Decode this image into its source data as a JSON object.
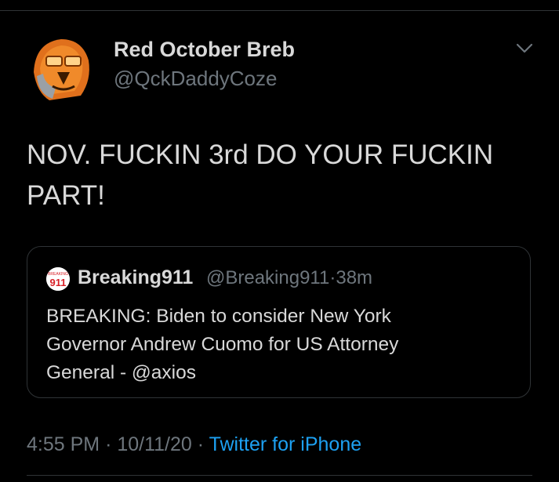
{
  "author": {
    "display_name": "Red October Breb",
    "handle": "@QckDaddyCoze",
    "avatar_icon": "hooded-mask-avatar"
  },
  "tweet": {
    "text_line1": "NOV. FUCKIN 3rd DO YOUR FUCKIN",
    "text_line2": "PART!"
  },
  "quoted_tweet": {
    "avatar_text": "911",
    "avatar_small_text": "BREAKING",
    "display_name": "Breaking911",
    "handle": "@Breaking911",
    "separator": "·",
    "age": "38m",
    "text_line1": "BREAKING: Biden to consider New York",
    "text_line2": "Governor Andrew Cuomo for US Attorney",
    "text_line3": "General - @axios"
  },
  "footer": {
    "time": "4:55 PM",
    "separator1": "·",
    "date": "10/11/20",
    "separator2": "·",
    "source": "Twitter for iPhone"
  },
  "colors": {
    "background": "#000000",
    "text": "#d9d9d9",
    "secondary_text": "#6e767d",
    "link": "#1da1f2",
    "border": "#2f3336",
    "badge_red": "#d81f26"
  }
}
